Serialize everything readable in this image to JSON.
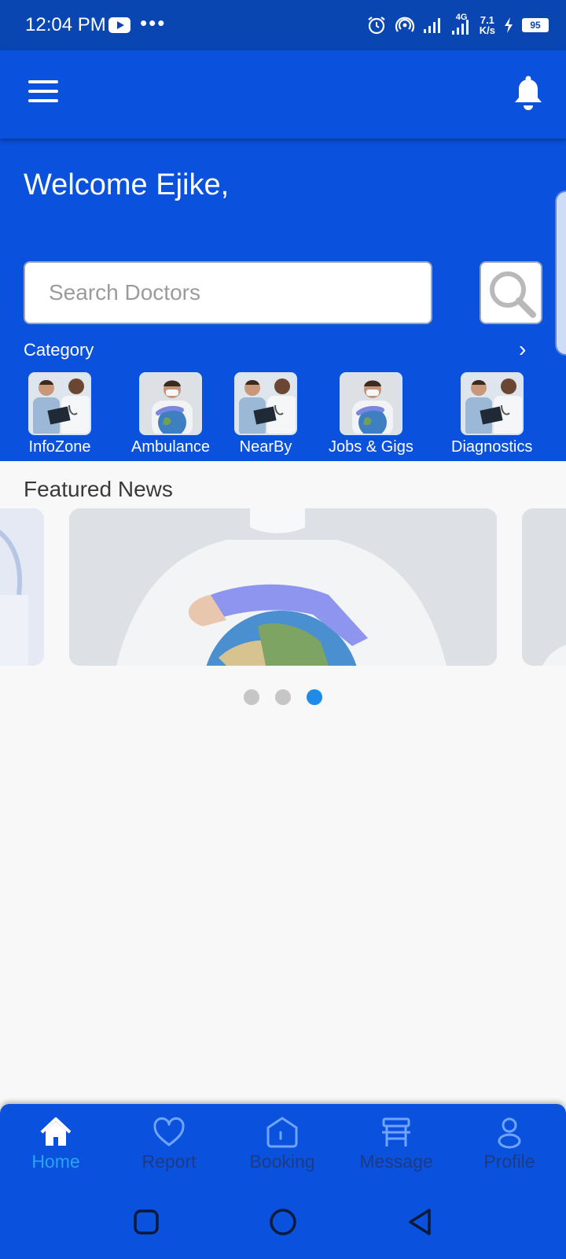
{
  "status_bar": {
    "time": "12:04 PM",
    "network": "4G",
    "speed_value": "7.1",
    "speed_unit": "K/s",
    "battery": "95"
  },
  "header": {
    "welcome": "Welcome Ejike,"
  },
  "search": {
    "placeholder": "Search Doctors"
  },
  "category": {
    "title": "Category",
    "items": [
      {
        "label": "InfoZone",
        "image": "doctors-consulting"
      },
      {
        "label": "Ambulance",
        "image": "masked-doctor-globe"
      },
      {
        "label": "NearBy",
        "image": "doctors-consulting"
      },
      {
        "label": "Jobs & Gigs",
        "image": "masked-doctor-globe"
      },
      {
        "label": "Diagnostics",
        "image": "doctors-consulting"
      }
    ]
  },
  "featured": {
    "title": "Featured News",
    "slide_count": 3,
    "active_index": 2
  },
  "bottom_nav": {
    "items": [
      {
        "label": "Home",
        "icon": "home-icon",
        "active": true
      },
      {
        "label": "Report",
        "icon": "heart-icon",
        "active": false
      },
      {
        "label": "Booking",
        "icon": "booking-icon",
        "active": false
      },
      {
        "label": "Message",
        "icon": "message-icon",
        "active": false
      },
      {
        "label": "Profile",
        "icon": "profile-icon",
        "active": false
      }
    ]
  },
  "colors": {
    "primary": "#0a52dd",
    "status_bar": "#0a46b2",
    "active_tab": "#2aa3f5",
    "inactive_tab": "#1c3b84",
    "dot_active": "#1f8ae8",
    "dot_inactive": "#c6c6c6"
  }
}
